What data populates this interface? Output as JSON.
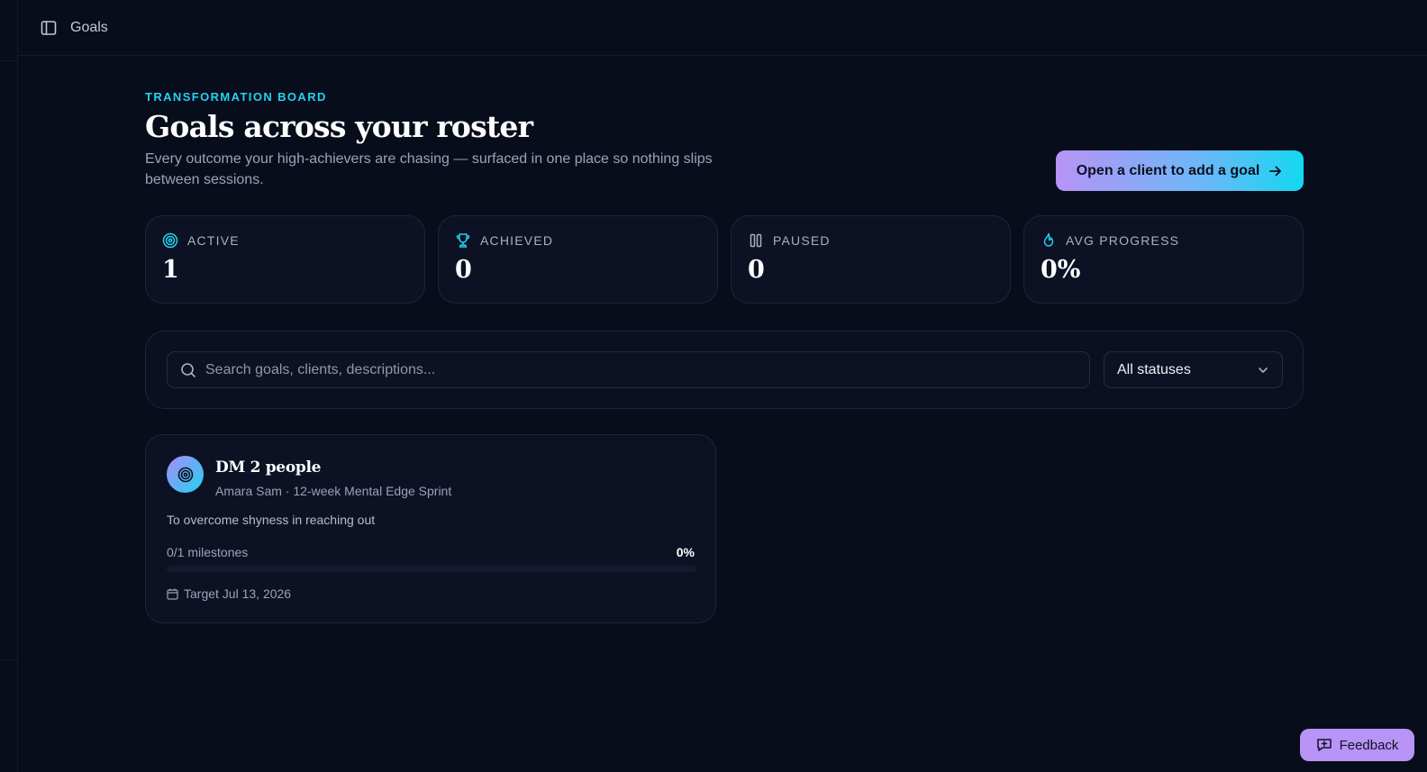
{
  "topbar": {
    "breadcrumb": "Goals"
  },
  "header": {
    "eyebrow": "TRANSFORMATION BOARD",
    "title": "Goals across your roster",
    "subtitle": "Every outcome your high-achievers are chasing — surfaced in one place so nothing slips between sessions.",
    "cta_label": "Open a client to add a goal"
  },
  "stats": [
    {
      "icon": "target-icon",
      "label": "ACTIVE",
      "value": "1"
    },
    {
      "icon": "trophy-icon",
      "label": "ACHIEVED",
      "value": "0"
    },
    {
      "icon": "pause-icon",
      "label": "PAUSED",
      "value": "0"
    },
    {
      "icon": "flame-icon",
      "label": "AVG PROGRESS",
      "value": "0%"
    }
  ],
  "filters": {
    "search_placeholder": "Search goals, clients, descriptions...",
    "search_value": "",
    "status_selected": "All statuses"
  },
  "goals": [
    {
      "title": "DM 2 people",
      "meta": "Amara Sam · 12-week Mental Edge Sprint",
      "description": "To overcome shyness in reaching out",
      "milestones": "0/1 milestones",
      "progress_label": "0%",
      "progress": 0,
      "target": "Target Jul 13, 2026"
    }
  ],
  "feedback_label": "Feedback",
  "colors": {
    "accent_cyan": "#22d3ee",
    "accent_purple": "#b794f6",
    "background": "#080d1c"
  }
}
